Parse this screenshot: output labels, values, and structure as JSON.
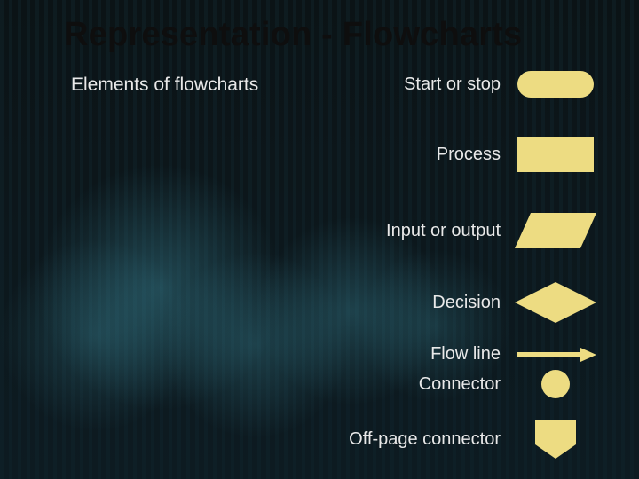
{
  "title": "Representation - Flowcharts",
  "subtitle": "Elements of flowcharts",
  "shape_color": "#eddc82",
  "items": [
    {
      "label": "Start or stop",
      "shape": "terminal"
    },
    {
      "label": "Process",
      "shape": "process"
    },
    {
      "label": "Input or output",
      "shape": "io"
    },
    {
      "label": "Decision",
      "shape": "decision"
    },
    {
      "label": "Flow line",
      "shape": "flowline"
    },
    {
      "label": "Connector",
      "shape": "connector"
    },
    {
      "label": "Off-page connector",
      "shape": "offpage"
    }
  ]
}
